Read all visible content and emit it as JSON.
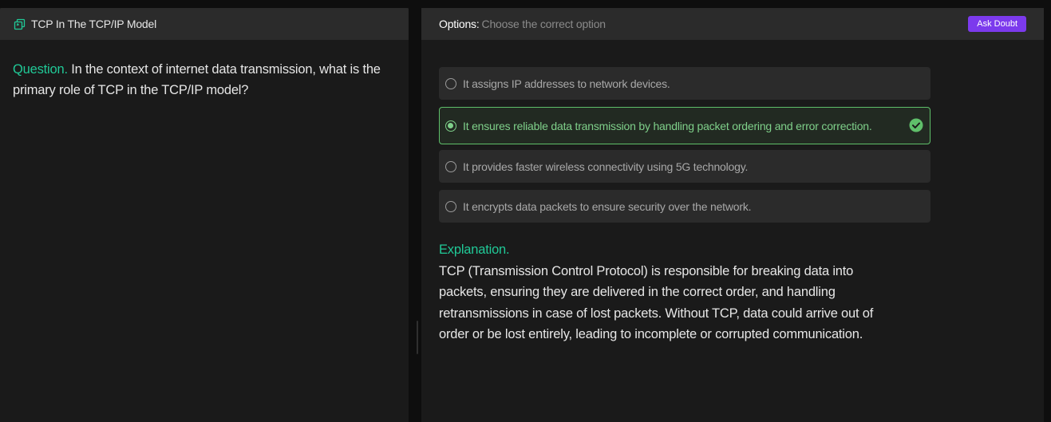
{
  "left_panel": {
    "title": "TCP In The TCP/IP Model",
    "question_label": "Question.",
    "question_text": "In the context of internet data transmission, what is the primary role of TCP in the TCP/IP model?"
  },
  "right_panel": {
    "options_label": "Options:",
    "options_hint": "Choose the correct option",
    "ask_doubt_label": "Ask Doubt",
    "options": [
      {
        "text": "It assigns IP addresses to network devices.",
        "selected": false,
        "correct": false
      },
      {
        "text": "It ensures reliable data transmission by handling packet ordering and error correction.",
        "selected": true,
        "correct": true
      },
      {
        "text": "It provides faster wireless connectivity using 5G technology.",
        "selected": false,
        "correct": false
      },
      {
        "text": "It encrypts data packets to ensure security over the network.",
        "selected": false,
        "correct": false
      }
    ],
    "explanation_title": "Explanation.",
    "explanation_text": "TCP (Transmission Control Protocol) is responsible for breaking data into packets, ensuring they are delivered in the correct order, and handling retransmissions in case of lost packets. Without TCP, data could arrive out of order or be lost entirely, leading to incomplete or corrupted communication."
  },
  "colors": {
    "accent_teal": "#20c997",
    "correct_green": "#5fbf6a",
    "ask_doubt_purple": "#7c3aed"
  },
  "icons": {
    "title_icon": "copy-icon",
    "correct_icon": "check-circle-icon"
  }
}
